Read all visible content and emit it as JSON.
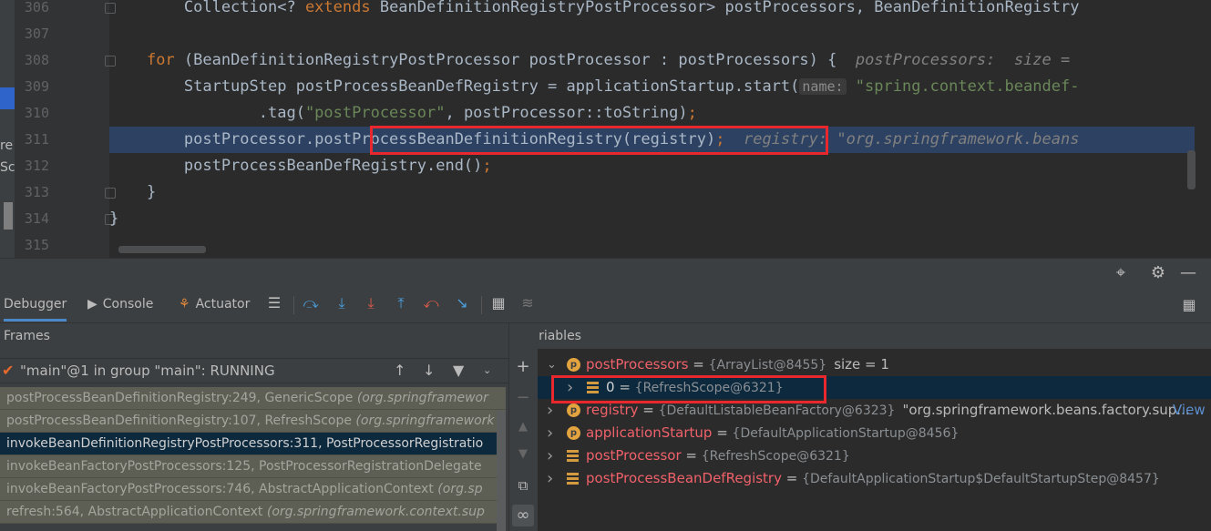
{
  "editor": {
    "left_fragments": [
      "re",
      "Sc"
    ],
    "lines": [
      {
        "no": "306",
        "parts": [
          {
            "t": "        Collection<? ",
            "c": ""
          },
          {
            "t": "extends",
            "c": "kw"
          },
          {
            "t": " BeanDefinitionRegistryPostProcessor> postProcessors, BeanDefinitionRegistry",
            "c": ""
          }
        ]
      },
      {
        "no": "307",
        "parts": []
      },
      {
        "no": "308",
        "parts": [
          {
            "t": "    ",
            "c": ""
          },
          {
            "t": "for",
            "c": "kw"
          },
          {
            "t": " (BeanDefinitionRegistryPostProcessor postProcessor : postProcessors) {  ",
            "c": ""
          },
          {
            "t": "postProcessors:  size =",
            "c": "hint"
          }
        ]
      },
      {
        "no": "309",
        "parts": [
          {
            "t": "        StartupStep postProcessBeanDefRegistry = applicationStartup.start(",
            "c": ""
          },
          {
            "t": "name:",
            "c": "param"
          },
          {
            "t": " ",
            "c": ""
          },
          {
            "t": "\"spring.context.beandef-",
            "c": "str"
          }
        ]
      },
      {
        "no": "310",
        "parts": [
          {
            "t": "                .tag(",
            "c": ""
          },
          {
            "t": "\"postProcessor\"",
            "c": "str"
          },
          {
            "t": ", postProcessor::toString)",
            "c": ""
          },
          {
            "t": ";",
            "c": "kw"
          }
        ]
      },
      {
        "no": "311",
        "parts": [
          {
            "t": "        postProcessor.postProcessBeanDefinitionRegistry(registry)",
            "c": ""
          },
          {
            "t": ";",
            "c": "kw"
          },
          {
            "t": "  registry: \"org.springframework.beans",
            "c": "hint"
          }
        ],
        "current": true
      },
      {
        "no": "312",
        "parts": [
          {
            "t": "        postProcessBeanDefRegistry.end()",
            "c": ""
          },
          {
            "t": ";",
            "c": "kw"
          }
        ]
      },
      {
        "no": "313",
        "parts": [
          {
            "t": "    }",
            "c": ""
          }
        ]
      },
      {
        "no": "314",
        "parts": [
          {
            "t": "}",
            "c": ""
          }
        ]
      },
      {
        "no": "315",
        "parts": []
      }
    ]
  },
  "tool_window": {
    "tabs": [
      {
        "label": "Debugger",
        "icon": "debugger-icon"
      },
      {
        "label": "Console",
        "icon": "console-icon"
      },
      {
        "label": "Actuator",
        "icon": "actuator-icon"
      }
    ],
    "header_icons": [
      "crosshair-icon",
      "gear-icon",
      "minimize-icon"
    ],
    "toolbar_icons": [
      "layout-icon",
      "show-execution-point-icon",
      "step-over-icon",
      "step-into-icon",
      "force-step-into-icon",
      "step-out-icon",
      "drop-frame-icon",
      "run-to-cursor-icon",
      "evaluate-expression-icon",
      "trace-stream-icon"
    ]
  },
  "frames": {
    "title": "Frames",
    "thread": "\"main\"@1 in group \"main\": RUNNING",
    "rows": [
      {
        "method": "postProcessBeanDefinitionRegistry:249, GenericScope ",
        "pkg": "(org.springframewor"
      },
      {
        "method": "postProcessBeanDefinitionRegistry:107, RefreshScope ",
        "pkg": "(org.springframework"
      },
      {
        "method": "invokeBeanDefinitionRegistryPostProcessors:311, PostProcessorRegistratio",
        "pkg": "",
        "selected": true
      },
      {
        "method": "invokeBeanFactoryPostProcessors:125, PostProcessorRegistrationDelegate",
        "pkg": ""
      },
      {
        "method": "invokeBeanFactoryPostProcessors:746, AbstractApplicationContext ",
        "pkg": "(org.sp"
      },
      {
        "method": "refresh:564, AbstractApplicationContext ",
        "pkg": "(org.springframework.context.sup"
      }
    ]
  },
  "variables": {
    "title": "Variables",
    "rows": [
      {
        "arrow": "v",
        "icon": "p",
        "name": "postProcessors",
        "value": "{ArrayList@8455}",
        "extra": "size = 1",
        "indent": 0
      },
      {
        "arrow": ">",
        "icon": "f",
        "name": "0",
        "value": "{RefreshScope@6321}",
        "extra": "",
        "indent": 1,
        "selected": true
      },
      {
        "arrow": ">",
        "icon": "p",
        "name": "registry",
        "value": "{DefaultListableBeanFactory@6323}",
        "extra": "\"org.springframework.beans.factory.sup...",
        "link": "View",
        "indent": 0
      },
      {
        "arrow": ">",
        "icon": "p",
        "name": "applicationStartup",
        "value": "{DefaultApplicationStartup@8456}",
        "extra": "",
        "indent": 0
      },
      {
        "arrow": ">",
        "icon": "f",
        "name": "postProcessor",
        "value": "{RefreshScope@6321}",
        "extra": "",
        "indent": 0
      },
      {
        "arrow": ">",
        "icon": "f",
        "name": "postProcessBeanDefRegistry",
        "value": "{DefaultApplicationStartup$DefaultStartupStep@8457}",
        "extra": "",
        "indent": 0
      }
    ]
  }
}
